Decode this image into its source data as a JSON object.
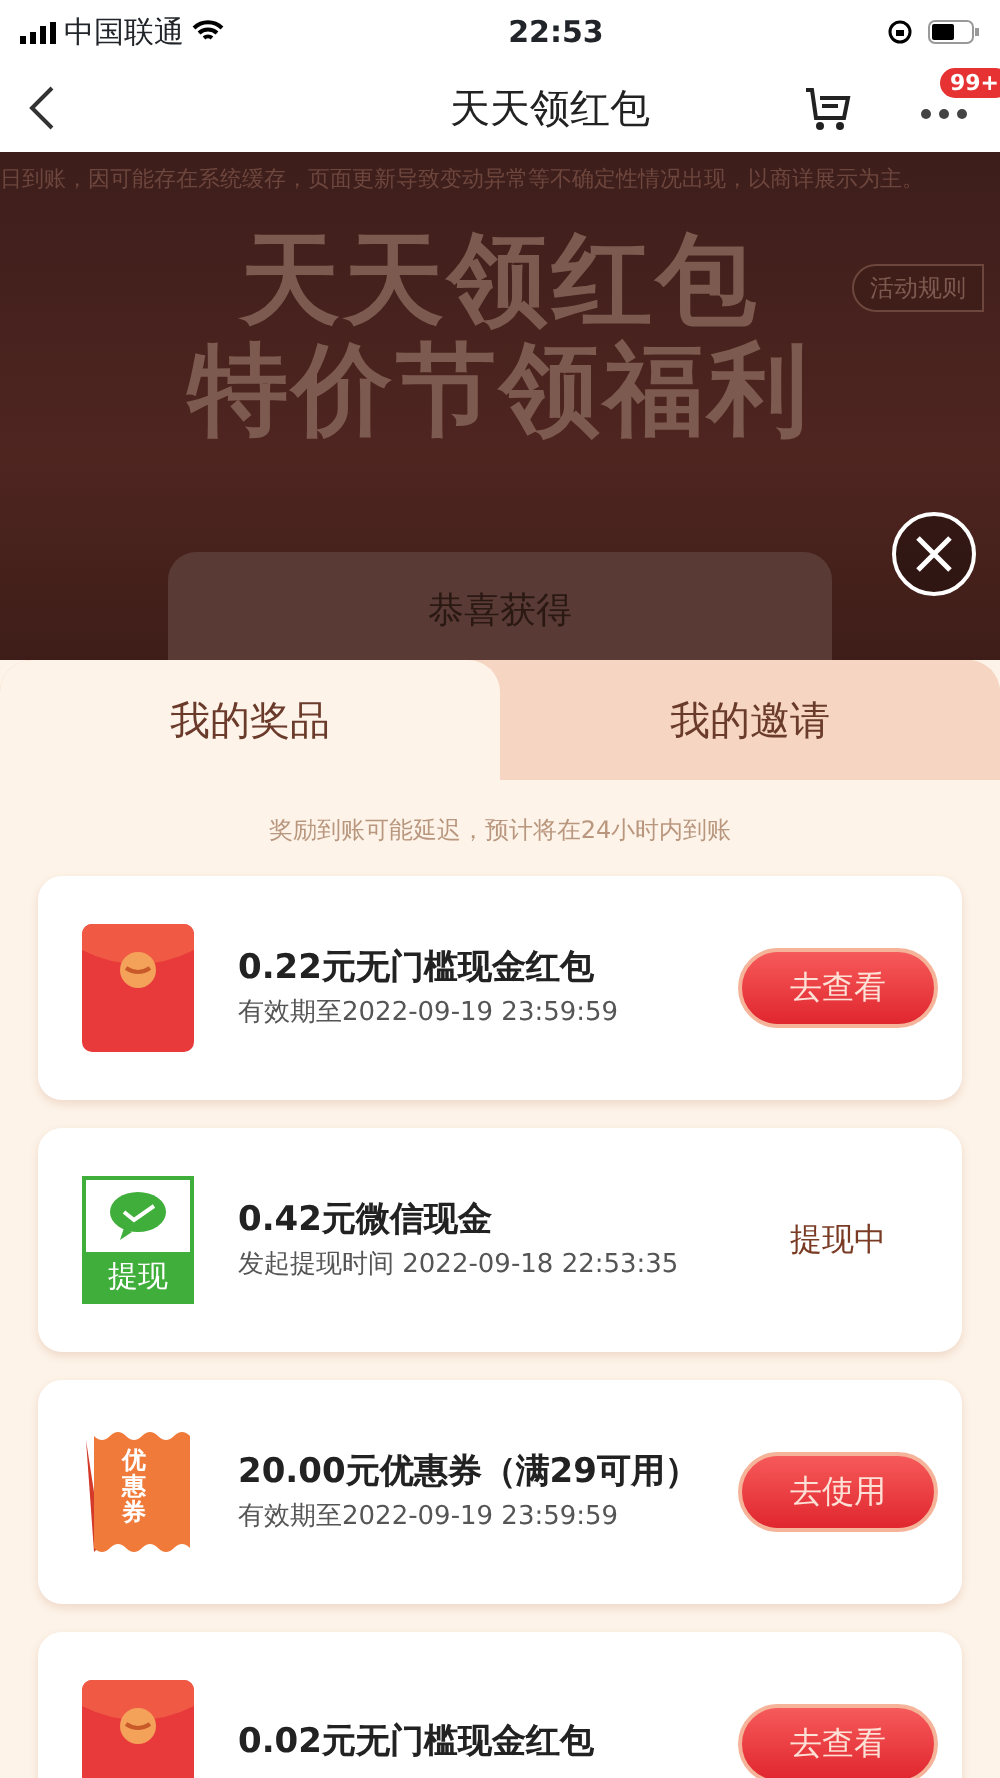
{
  "status_bar": {
    "carrier": "中国联通",
    "time": "22:53"
  },
  "nav": {
    "title": "天天领红包",
    "badge": "99+"
  },
  "banner": {
    "notice": "日到账，因可能存在系统缓存，页面更新导致变动异常等不确定性情况出现，以商详展示为主。",
    "title_line_1": "天天领红包",
    "title_line_2": "特价节领福利",
    "rules_button": "活动规则",
    "prize_card_title": "恭喜获得"
  },
  "tabs": [
    {
      "label": "我的奖品",
      "selected": true
    },
    {
      "label": "我的邀请",
      "selected": false
    }
  ],
  "notice": "奖励到账可能延迟，预计将在24小时内到账",
  "prizes": [
    {
      "kind": "redpacket",
      "title": "0.22元无门槛现金红包",
      "subtitle": "有效期至2022-09-19 23:59:59",
      "action": {
        "kind": "button",
        "label": "去查看"
      }
    },
    {
      "kind": "wechat",
      "icon_label": "提现",
      "title": "0.42元微信现金",
      "subtitle": "发起提现时间 2022-09-18 22:53:35",
      "action": {
        "kind": "status",
        "label": "提现中"
      }
    },
    {
      "kind": "coupon",
      "icon_label": "优惠券",
      "title": "20.00元优惠券（满29可用）",
      "subtitle": "有效期至2022-09-19 23:59:59",
      "action": {
        "kind": "button",
        "label": "去使用"
      }
    },
    {
      "kind": "redpacket",
      "title": "0.02元无门槛现金红包",
      "action": {
        "kind": "button",
        "label": "去查看"
      }
    }
  ]
}
